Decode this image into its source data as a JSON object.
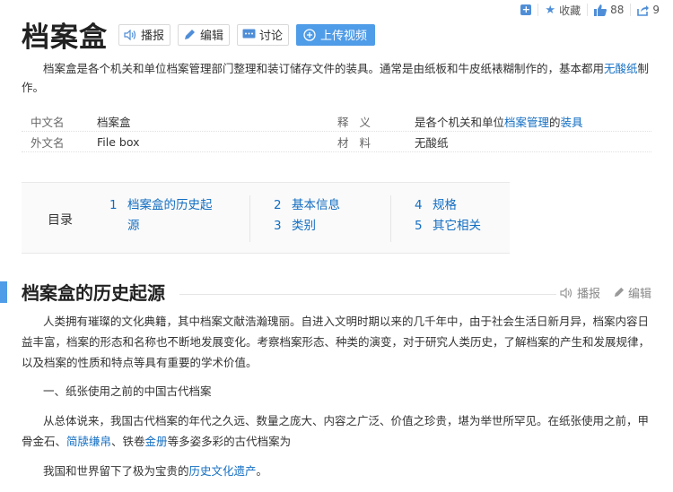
{
  "topbar": {
    "collect_label": "收藏",
    "like_count": "88",
    "share_count": "9"
  },
  "title": "档案盒",
  "buttons": {
    "play": "播报",
    "edit": "编辑",
    "discuss": "讨论",
    "upload": "上传视频"
  },
  "summary": {
    "text": "档案盒是各个机关和单位档案管理部门整理和装订储存文件的装具。通常是由纸板和牛皮纸裱糊制作的，基本都用",
    "link": "无酸纸",
    "tail": "制作。"
  },
  "basic_info": {
    "row1": {
      "k1": "中文名",
      "v1": "档案盒",
      "k2": "释义",
      "v2_pre": "是各个机关和单位",
      "v2_link1": "档案管理",
      "v2_mid": "的",
      "v2_link2": "装具"
    },
    "row2": {
      "k1": "外文名",
      "v1": "File box",
      "k2": "材料",
      "v2": "无酸纸"
    }
  },
  "toc": {
    "label": "目录",
    "items": [
      {
        "num": "1",
        "text_a": "档案盒的历史起",
        "text_b": "源"
      },
      {
        "num": "2",
        "text": "基本信息"
      },
      {
        "num": "3",
        "text": "类别"
      },
      {
        "num": "4",
        "text": "规格"
      },
      {
        "num": "5",
        "text": "其它相关"
      }
    ]
  },
  "section": {
    "title": "档案盒的历史起源",
    "play": "播报",
    "edit": "编辑"
  },
  "body": {
    "p1": "人类拥有璀璨的文化典籍，其中档案文献浩瀚瑰丽。自进入文明时期以来的几千年中，由于社会生活日新月异，档案内容日益丰富，档案的形态和名称也不断地发展变化。考察档案形态、种类的演变，对于研究人类历史，了解档案的产生和发展规律，以及档案的性质和特点等具有重要的学术价值。",
    "p2": "一、纸张使用之前的中国古代档案",
    "p3_a": "从总体说来，我国古代档案的年代之久远、数量之庞大、内容之广泛、价值之珍贵，堪为举世所罕见。在纸张使用之前，甲骨金石、",
    "p3_link1": "简牍缣帛",
    "p3_b": "、铁卷",
    "p3_link2": "金册",
    "p3_c": "等多姿多彩的古代档案为",
    "p4_a": "我国和世界留下了极为宝贵的",
    "p4_link": "历史文化遗产",
    "p4_b": "。"
  }
}
